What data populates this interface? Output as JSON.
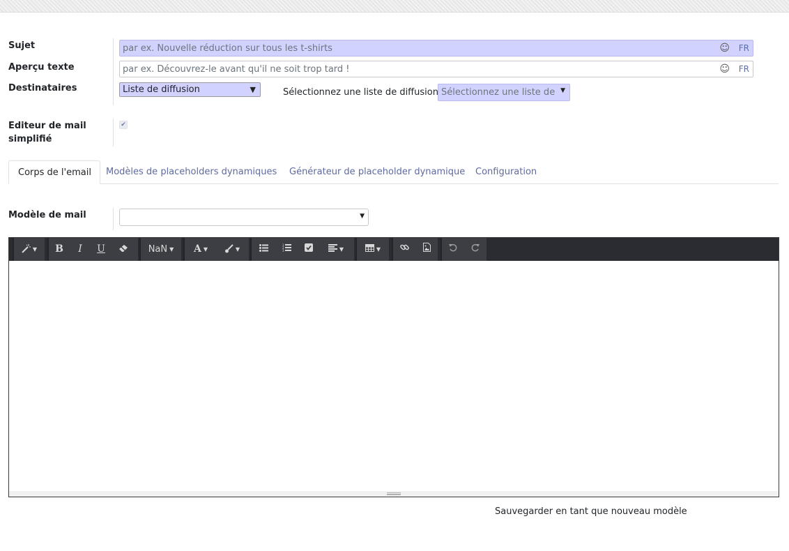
{
  "form": {
    "subject": {
      "label": "Sujet",
      "placeholder": "par ex. Nouvelle réduction sur tous les t-shirts",
      "emoji": "☺",
      "lang": "FR"
    },
    "preview": {
      "label": "Aperçu texte",
      "placeholder": "par ex. Découvrez-le avant qu'il ne soit trop tard !",
      "emoji": "☺",
      "lang": "FR"
    },
    "recipients": {
      "label": "Destinataires",
      "selected": "Liste de diffusion",
      "list_label": "Sélectionnez une liste de diffusion",
      "list_placeholder": "Sélectionnez une liste de diffusion"
    },
    "simple_editor": {
      "label_line1": "Editeur de mail",
      "label_line2": "simplifié",
      "checked": true,
      "check_glyph": "✔"
    }
  },
  "tabs": [
    {
      "label": "Corps de l'email",
      "active": true
    },
    {
      "label": "Modèles de placeholders dynamiques",
      "active": false
    },
    {
      "label": "Générateur de placeholder dynamique",
      "active": false
    },
    {
      "label": "Configuration",
      "active": false
    }
  ],
  "mail_template": {
    "label": "Modèle de mail",
    "value": ""
  },
  "toolbar": {
    "font_size_label": "NaN",
    "bold": "B",
    "italic": "I",
    "underline": "U",
    "font_color": "A",
    "icons": [
      "magic-wand-icon",
      "bold-icon",
      "italic-icon",
      "underline-icon",
      "eraser-icon",
      "font-size-icon",
      "font-color-icon",
      "brush-icon",
      "bullet-list-icon",
      "numbered-list-icon",
      "checklist-icon",
      "align-icon",
      "table-icon",
      "link-icon",
      "image-icon",
      "undo-icon",
      "redo-icon"
    ]
  },
  "save_template_label": "Sauvegarder en tant que nouveau modèle",
  "colors": {
    "required_bg": "#d2d2ff",
    "accent": "#5f6aa0",
    "toolbar_bg": "#2b2c31"
  }
}
